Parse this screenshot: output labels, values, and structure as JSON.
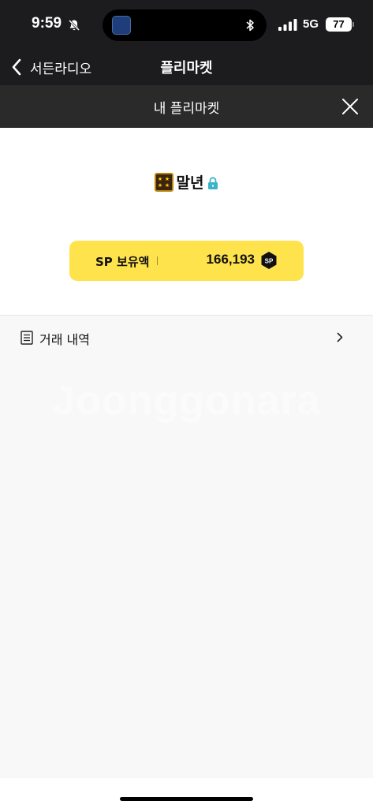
{
  "status_bar": {
    "time": "9:59",
    "network": "5G",
    "battery": "77"
  },
  "nav": {
    "back_label": "서든라디오",
    "title": "플리마켓"
  },
  "sub_header": {
    "title": "내 플리마켓"
  },
  "profile": {
    "username": "말년",
    "sp_label": "SP 보유액",
    "sp_amount": "166,193",
    "sp_coin_text": "SP"
  },
  "menu": {
    "history_label": "거래 내역"
  },
  "watermark": "Joonggonara",
  "colors": {
    "dark_bg": "#1c1c1e",
    "sub_header_bg": "#2a2a2a",
    "sp_yellow": "#ffe34d",
    "lock_teal": "#3bb3c9"
  }
}
